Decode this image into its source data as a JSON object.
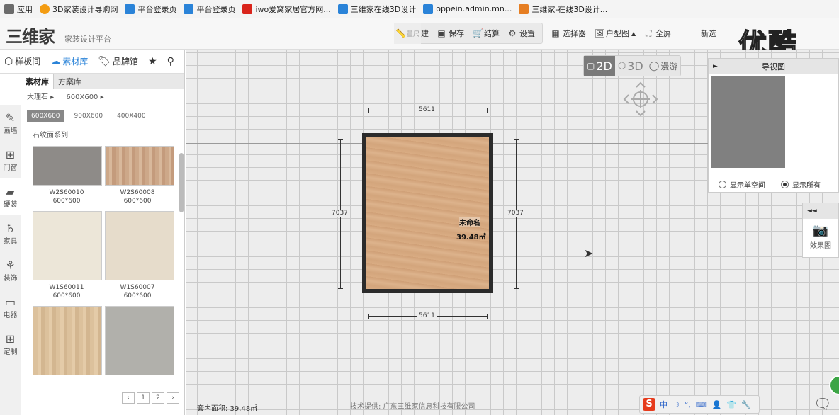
{
  "bookmarks": [
    {
      "label": "应用",
      "color": "#6b6b6b"
    },
    {
      "label": "3D家装设计导购网",
      "color": "#f39c12"
    },
    {
      "label": "平台登录页",
      "color": "#2a83d8"
    },
    {
      "label": "平台登录页",
      "color": "#2a83d8"
    },
    {
      "label": "iwo爱窝家居官方网...",
      "color": "#d9241b"
    },
    {
      "label": "三维家在线3D设计",
      "color": "#2a83d8"
    },
    {
      "label": "oppein.admin.mn...",
      "color": "#2a83d8"
    },
    {
      "label": "三维家-在线3D设计...",
      "color": "#e67e22"
    }
  ],
  "header": {
    "logo": "三维家",
    "subtitle": "家装设计平台",
    "toolbar": [
      {
        "label": "新建",
        "icon": "new-file-icon"
      },
      {
        "label": "保存",
        "icon": "save-icon"
      },
      {
        "label": "结算",
        "icon": "cart-icon"
      },
      {
        "label": "设置",
        "icon": "gear-icon"
      }
    ],
    "tools": [
      {
        "label": "量尺",
        "icon": "ruler-icon"
      },
      {
        "label": "选择器",
        "icon": "grid-select-icon"
      },
      {
        "label": "户型图",
        "icon": "floorplan-icon"
      },
      {
        "label": "全屏",
        "icon": "fullscreen-icon"
      },
      {
        "label": "新选",
        "icon": "new-select-icon"
      }
    ],
    "watermark": "优酷"
  },
  "left_panel": {
    "tabs": [
      {
        "label": "样板间",
        "icon": "box-icon",
        "active": false
      },
      {
        "label": "素材库",
        "icon": "cloud-icon",
        "active": true
      },
      {
        "label": "品牌馆",
        "icon": "tag-icon",
        "active": false
      }
    ],
    "subtabs": [
      {
        "label": "素材库",
        "active": true
      },
      {
        "label": "方案库",
        "active": false
      }
    ],
    "breadcrumb": [
      "大理石 ▸",
      "600X600 ▸"
    ],
    "sizes": [
      {
        "label": "600X600",
        "active": true
      },
      {
        "label": "900X600",
        "active": false
      },
      {
        "label": "400X400",
        "active": false
      }
    ],
    "series": "石纹面系列",
    "materials": [
      {
        "code": "W2S60010",
        "size": "600*600",
        "color": "#8e8b88"
      },
      {
        "code": "W2S60008",
        "size": "600*600",
        "color": "#cda889"
      },
      {
        "code": "W1S60011",
        "size": "600*600",
        "color": "#ece6d8"
      },
      {
        "code": "W1S60007",
        "size": "600*600",
        "color": "#e6dccb"
      },
      {
        "code": "",
        "size": "",
        "color": "#dcc19c"
      },
      {
        "code": "",
        "size": "",
        "color": "#b1b0ab"
      }
    ],
    "pager": [
      "‹",
      "1",
      "2",
      "›"
    ]
  },
  "rail": [
    {
      "label": "画墙",
      "icon": "pencil-icon"
    },
    {
      "label": "门窗",
      "icon": "window-icon"
    },
    {
      "label": "硬装",
      "icon": "paint-roller-icon"
    },
    {
      "label": "家具",
      "icon": "chair-icon"
    },
    {
      "label": "装饰",
      "icon": "plant-icon"
    },
    {
      "label": "电器",
      "icon": "monitor-icon"
    },
    {
      "label": "定制",
      "icon": "grid-icon"
    }
  ],
  "canvas": {
    "room_name": "未命名",
    "room_area": "39.48㎡",
    "dim_top": "5611",
    "dim_bottom": "5611",
    "dim_left": "7037",
    "dim_right": "7037"
  },
  "views": [
    {
      "label": "2D",
      "active": true
    },
    {
      "label": "3D",
      "active": false
    },
    {
      "label": "漫游",
      "active": false
    }
  ],
  "nav_panel": {
    "title": "导视图",
    "options": [
      {
        "label": "显示单空间",
        "checked": false
      },
      {
        "label": "显示所有",
        "checked": true
      }
    ]
  },
  "effect_panel": {
    "label": "效果图"
  },
  "status": {
    "area_label": "套内面积: 39.48㎡"
  },
  "footer": "技术提供: 广东三维家信息科技有限公司",
  "ime": {
    "items": [
      "中",
      "☽",
      "°,",
      "⌨",
      "👤",
      "👕",
      "🔧"
    ]
  }
}
